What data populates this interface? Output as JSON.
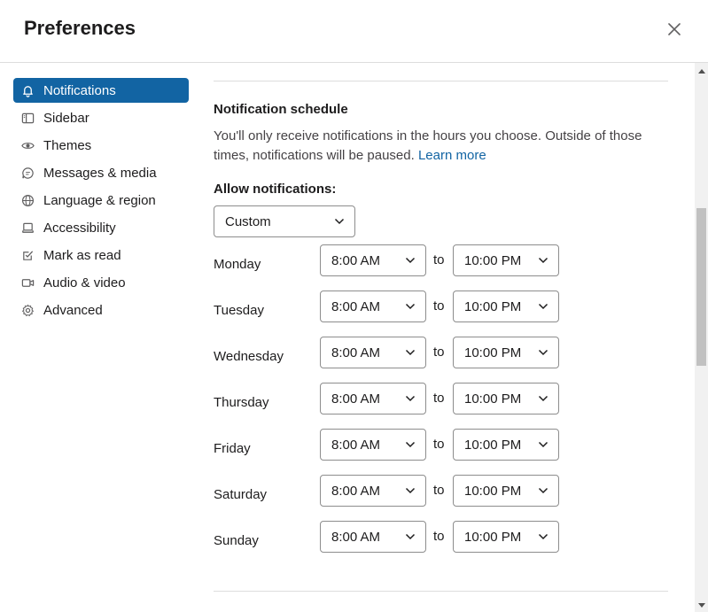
{
  "header": {
    "title": "Preferences"
  },
  "sidebar": {
    "items": [
      {
        "label": "Notifications",
        "icon": "bell-icon",
        "active": true
      },
      {
        "label": "Sidebar",
        "icon": "sidebar-icon"
      },
      {
        "label": "Themes",
        "icon": "eye-icon"
      },
      {
        "label": "Messages & media",
        "icon": "message-icon"
      },
      {
        "label": "Language & region",
        "icon": "globe-icon"
      },
      {
        "label": "Accessibility",
        "icon": "laptop-icon"
      },
      {
        "label": "Mark as read",
        "icon": "check-square-icon"
      },
      {
        "label": "Audio & video",
        "icon": "video-icon"
      },
      {
        "label": "Advanced",
        "icon": "gear-icon"
      }
    ]
  },
  "schedule": {
    "title": "Notification schedule",
    "description": "You'll only receive notifications in the hours you choose. Outside of those times, notifications will be paused.",
    "learn_more": "Learn more",
    "allow_label": "Allow notifications:",
    "allow_value": "Custom",
    "to_label": "to",
    "days": [
      {
        "day": "Monday",
        "start": "8:00 AM",
        "end": "10:00 PM"
      },
      {
        "day": "Tuesday",
        "start": "8:00 AM",
        "end": "10:00 PM"
      },
      {
        "day": "Wednesday",
        "start": "8:00 AM",
        "end": "10:00 PM"
      },
      {
        "day": "Thursday",
        "start": "8:00 AM",
        "end": "10:00 PM"
      },
      {
        "day": "Friday",
        "start": "8:00 AM",
        "end": "10:00 PM"
      },
      {
        "day": "Saturday",
        "start": "8:00 AM",
        "end": "10:00 PM"
      },
      {
        "day": "Sunday",
        "start": "8:00 AM",
        "end": "10:00 PM"
      }
    ]
  },
  "colors": {
    "accent": "#1264a3",
    "text": "#1d1c1d",
    "muted": "#454245",
    "border": "#8d8d8d"
  }
}
